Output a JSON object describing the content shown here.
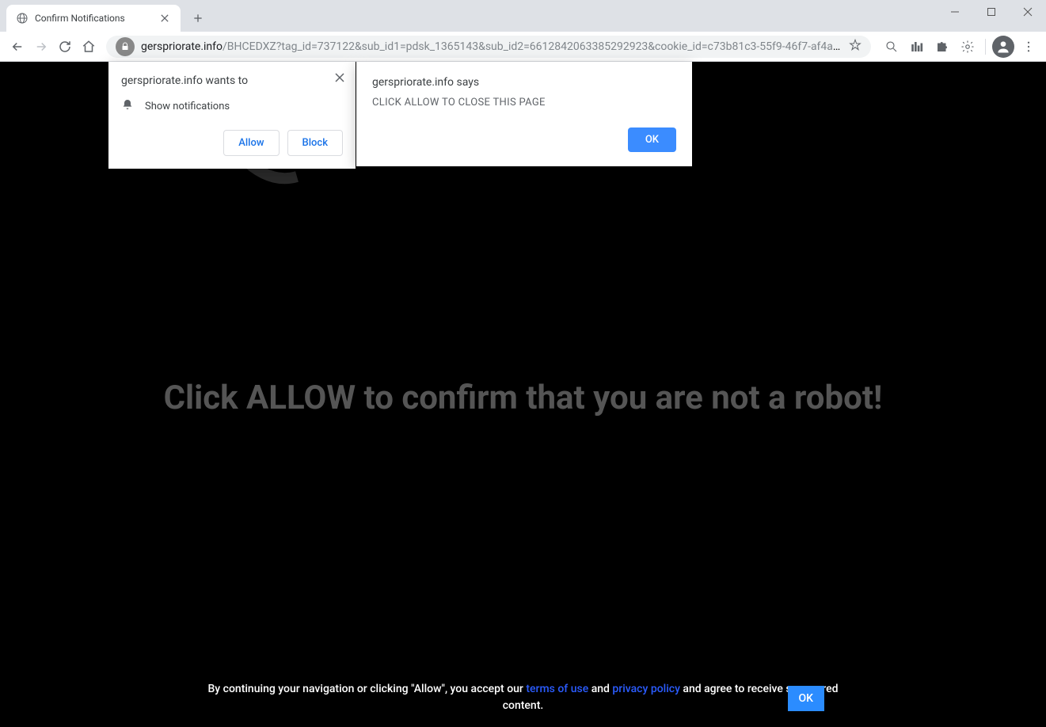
{
  "window": {
    "tab_title": "Confirm Notifications"
  },
  "url": {
    "host": "gerspriorate.info",
    "path": "/BHCEDXZ?tag_id=737122&sub_id1=pdsk_1365143&sub_id2=6612842063385292923&cookie_id=c73b81c3-55f9-46f7-af4a-1..."
  },
  "perm_popup": {
    "title": "gerspriorate.info wants to",
    "permission": "Show notifications",
    "allow": "Allow",
    "block": "Block"
  },
  "alert_popup": {
    "title": "gerspriorate.info says",
    "message": "CLICK ALLOW TO CLOSE THIS PAGE",
    "ok": "OK"
  },
  "page": {
    "main_text": "Click ALLOW to confirm that you are not a robot!",
    "footer_pre": "By continuing your navigation or clicking \"Allow\", you accept our ",
    "footer_tos": "terms of use",
    "footer_mid": " and ",
    "footer_pp": "privacy policy",
    "footer_post": " and agree to receive sponsored content.",
    "footer_ok": "OK"
  }
}
